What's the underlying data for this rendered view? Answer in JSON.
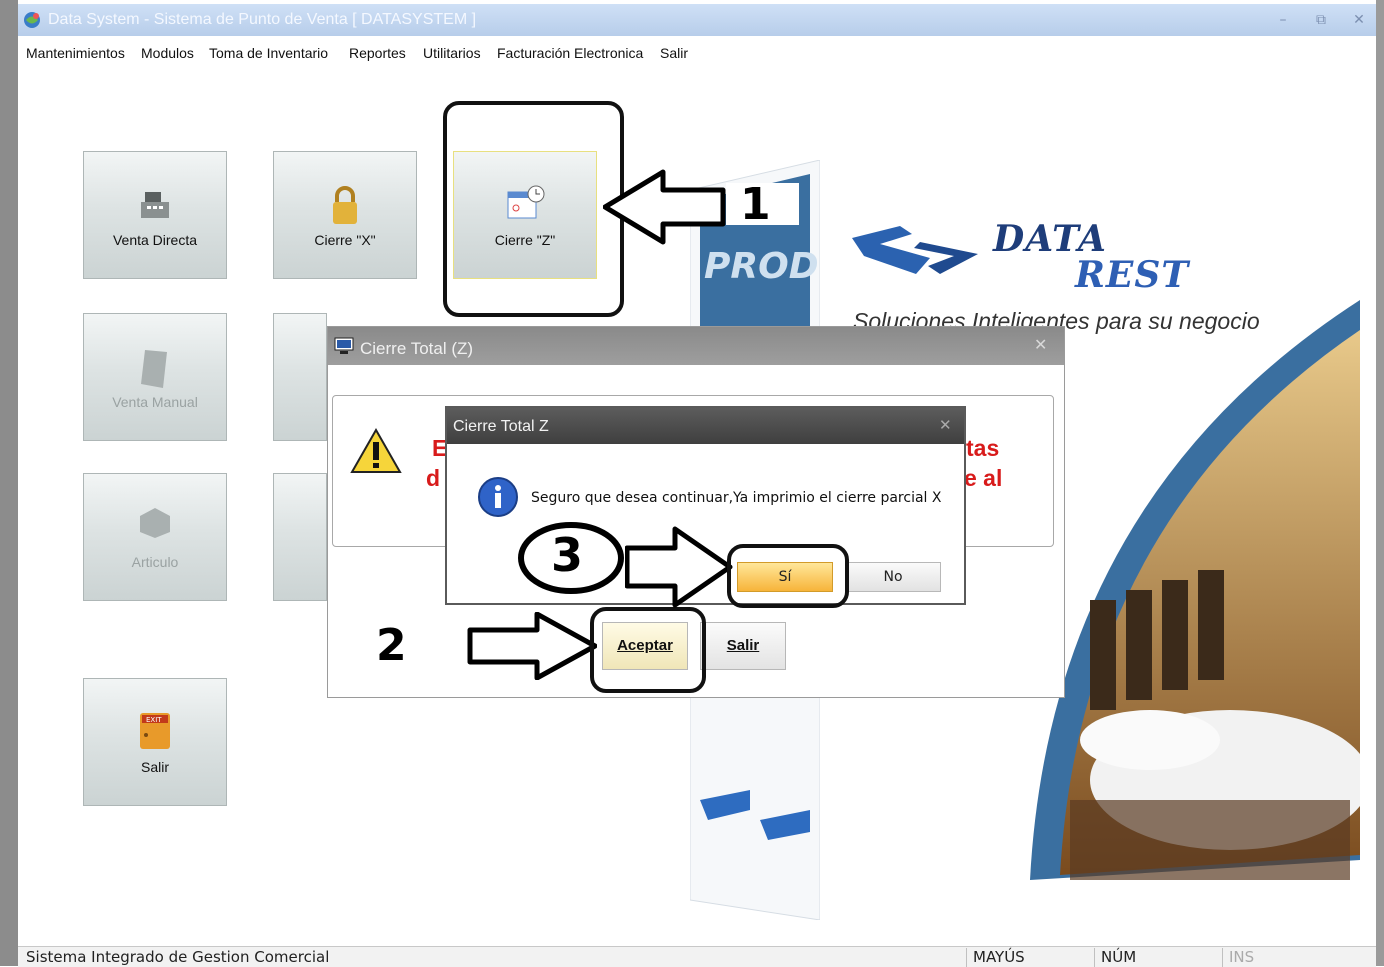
{
  "window": {
    "title": "Data System - Sistema de Punto de Venta [ DATASYSTEM ]",
    "minimize": "–",
    "restore": "⧉",
    "close": "✕"
  },
  "menu": {
    "items": [
      {
        "label": "Mantenimientos"
      },
      {
        "label": "Modulos"
      },
      {
        "label": "Toma de Inventario"
      },
      {
        "label": "Reportes"
      },
      {
        "label": "Utilitarios"
      },
      {
        "label": "Facturación Electronica"
      },
      {
        "label": "Salir"
      }
    ]
  },
  "tiles": {
    "venta_directa": "Venta Directa",
    "cierre_x": "Cierre \"X\"",
    "cierre_z": "Cierre \"Z\"",
    "venta_manual": "Venta Manual",
    "articulo": "Articulo",
    "salir": "Salir"
  },
  "branding": {
    "prod": "PROD",
    "logo_line1": "DATA",
    "logo_line2": "REST",
    "slogan": "Soluciones Inteligentes para su negocio"
  },
  "dialog_cierre_total": {
    "title": "Cierre Total (Z)",
    "close": "✕",
    "red_left_1": "E",
    "red_left_2": "d",
    "red_right_1": "tas",
    "red_right_2": "e al",
    "accept": "Aceptar",
    "exit": "Salir"
  },
  "dialog_confirm": {
    "title": "Cierre Total Z",
    "close": "✕",
    "message": "Seguro que desea continuar,Ya imprimio el cierre parcial X",
    "yes": "Sí",
    "no": "No"
  },
  "annotations": {
    "step1": "1",
    "step2": "2",
    "step3": "3"
  },
  "statusbar": {
    "text": "Sistema Integrado de Gestion Comercial",
    "caps": "MAYÚS",
    "num": "NÚM",
    "ins": "INS"
  },
  "colors": {
    "accent_red": "#d81b1b",
    "brand_blue": "#2e5fb4",
    "yes_button": "#f7c04a"
  }
}
